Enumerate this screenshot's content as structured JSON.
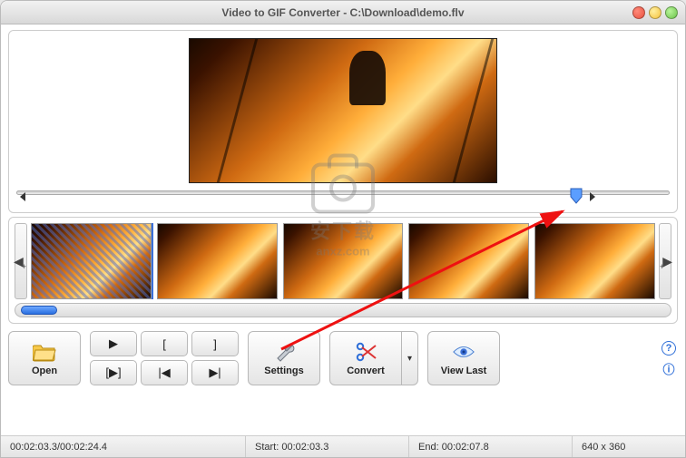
{
  "window": {
    "title": "Video to GIF Converter - C:\\Download\\demo.flv"
  },
  "toolbar": {
    "open": "Open",
    "settings": "Settings",
    "convert": "Convert",
    "view_last": "View Last"
  },
  "playback": {
    "play": "▶",
    "mark_in": "[",
    "mark_out": "]",
    "range": "[▶]",
    "prev": "|◀",
    "next": "▶|"
  },
  "status": {
    "time": "00:02:03.3/00:02:24.4",
    "start_label": "Start:",
    "start": "00:02:03.3",
    "end_label": "End:",
    "end": "00:02:07.8",
    "dimensions": "640 x 360"
  },
  "thumbnails": {
    "count": 5,
    "selected_index": 0
  },
  "timeline": {
    "playhead_percent": 86
  },
  "watermark": {
    "line1": "安下载",
    "line2": "anxz.com"
  },
  "icons": {
    "folder": "folder-icon",
    "tools": "tools-icon",
    "scissors": "scissors-icon",
    "eye": "eye-icon",
    "help": "help-icon",
    "info": "info-icon"
  }
}
